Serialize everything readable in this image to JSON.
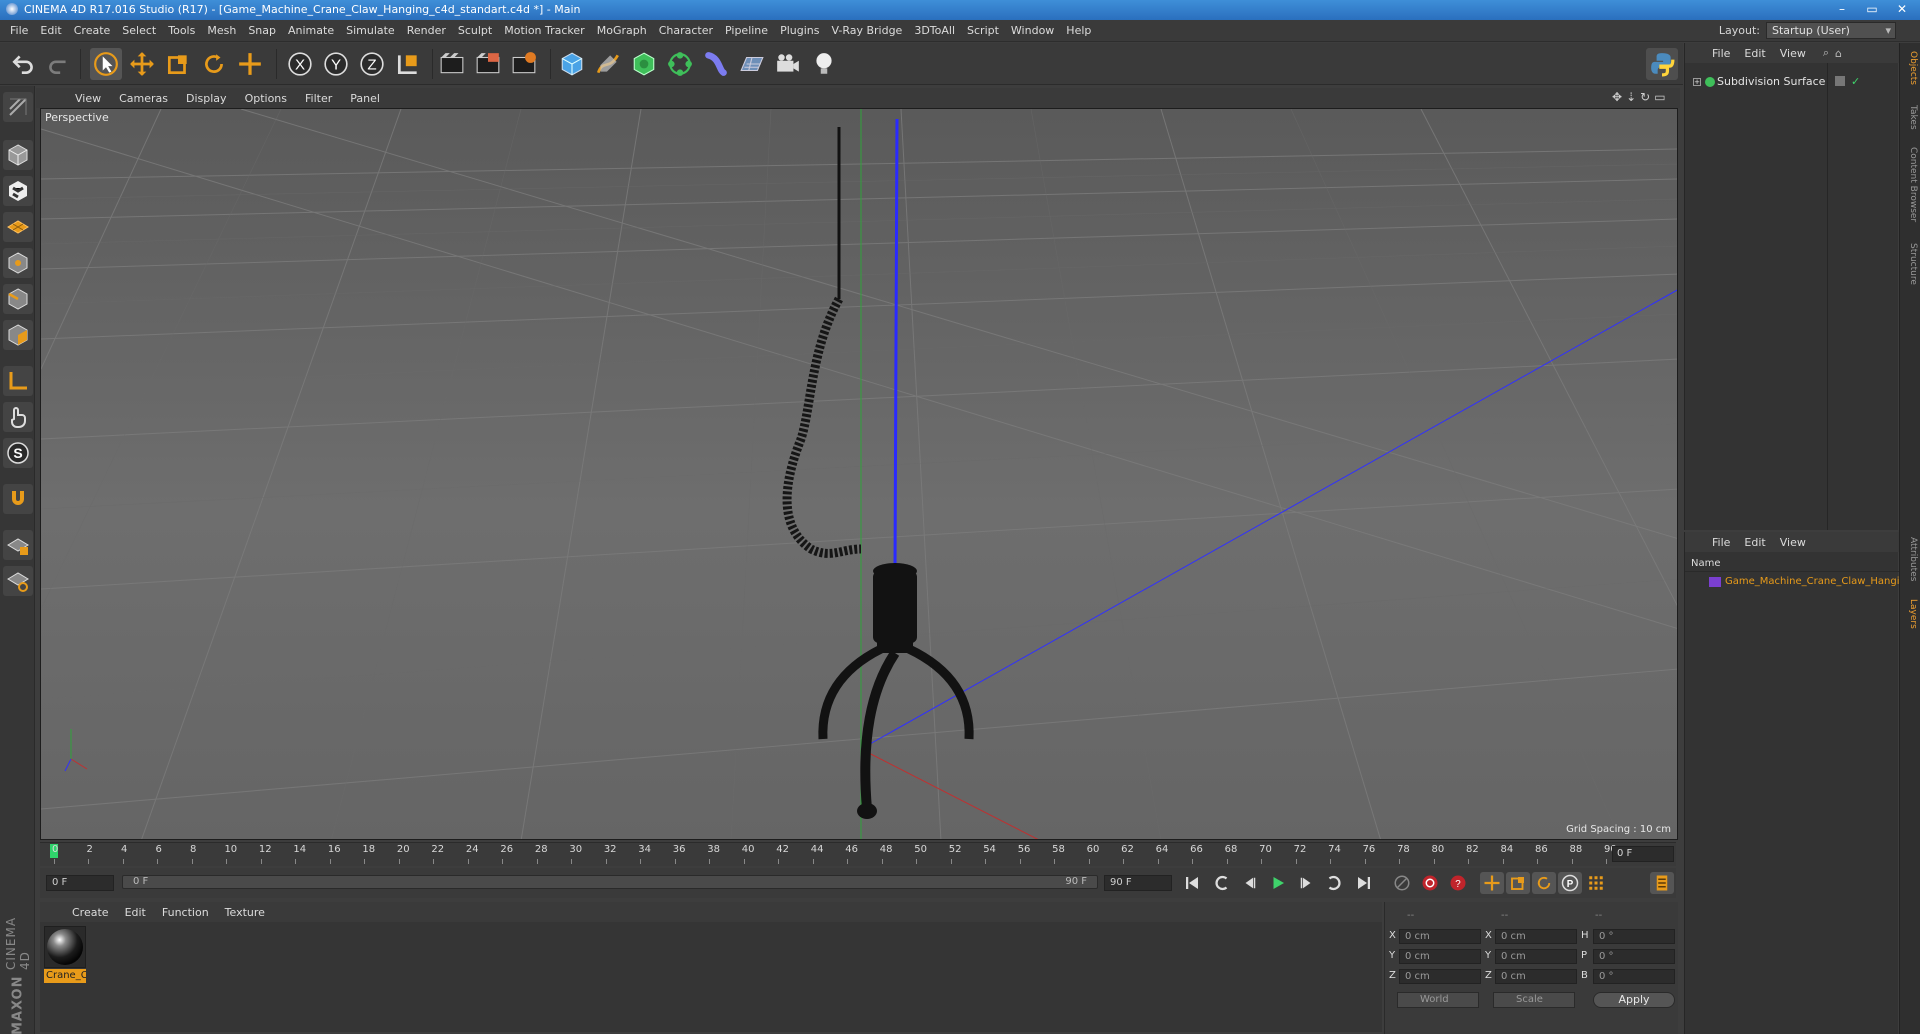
{
  "window": {
    "title": "CINEMA 4D R17.016 Studio (R17) - [Game_Machine_Crane_Claw_Hanging_c4d_standart.c4d *] - Main",
    "controls": [
      "–",
      "▭",
      "✕"
    ]
  },
  "menubar": {
    "items": [
      "File",
      "Edit",
      "Create",
      "Select",
      "Tools",
      "Mesh",
      "Snap",
      "Animate",
      "Simulate",
      "Render",
      "Sculpt",
      "Motion Tracker",
      "MoGraph",
      "Character",
      "Pipeline",
      "Plugins",
      "V-Ray Bridge",
      "3DToAll",
      "Script",
      "Window",
      "Help"
    ],
    "layout_label": "Layout:",
    "layout_value": "Startup (User)"
  },
  "toolbar": {
    "icons": [
      "undo-icon",
      "redo-icon",
      "select-arrow-icon",
      "move-icon",
      "scale-icon",
      "rotate-icon",
      "add-object-icon",
      "x-axis-icon",
      "y-axis-icon",
      "z-axis-icon",
      "world-coord-icon",
      "render-view-icon",
      "render-picture-viewer-icon",
      "edit-render-settings-icon",
      "cube-icon",
      "pen-spline-icon",
      "subdivision-icon",
      "array-icon",
      "deformer-icon",
      "floor-icon",
      "camera-icon",
      "light-icon",
      "python-icon"
    ],
    "axis_x": "X",
    "axis_y": "Y",
    "axis_z": "Z"
  },
  "left_palette": {
    "icons": [
      "make-editable-icon",
      "model-mode-icon",
      "texture-mode-icon",
      "workplane-icon",
      "points-mode-icon",
      "edges-mode-icon",
      "polygons-mode-icon",
      "axis-mode-icon",
      "tweak-mode-icon",
      "snap-icon",
      "magnet-icon",
      "lock-workplane-icon",
      "locked-grid-icon"
    ],
    "snap_letter": "S"
  },
  "viewport": {
    "menu": [
      "View",
      "Cameras",
      "Display",
      "Options",
      "Filter",
      "Panel"
    ],
    "label": "Perspective",
    "grid_spacing": "Grid Spacing : 10 cm",
    "nav_icons": [
      "move-view-icon",
      "zoom-view-icon",
      "rotate-view-icon",
      "toggle-view-icon"
    ]
  },
  "timeline": {
    "ticks": [
      "0",
      "2",
      "4",
      "6",
      "8",
      "10",
      "12",
      "14",
      "16",
      "18",
      "20",
      "22",
      "24",
      "26",
      "28",
      "30",
      "32",
      "34",
      "36",
      "38",
      "40",
      "42",
      "44",
      "46",
      "48",
      "50",
      "52",
      "54",
      "56",
      "58",
      "60",
      "62",
      "64",
      "66",
      "68",
      "70",
      "72",
      "74",
      "76",
      "78",
      "80",
      "82",
      "84",
      "86",
      "88",
      "90"
    ],
    "current_frame": "0 F"
  },
  "playback": {
    "start_field": "0 F",
    "range_start": "0 F",
    "range_end": "90 F",
    "end_field": "90 F",
    "icons": [
      "go-to-start-icon",
      "prev-key-icon",
      "prev-frame-icon",
      "play-icon",
      "next-frame-icon",
      "next-key-icon",
      "go-to-end-icon",
      "keyframe-selection-icon",
      "record-icon",
      "autokey-icon",
      "key-move-icon",
      "key-scale-icon",
      "key-rotate-icon",
      "key-param-icon",
      "key-pla-icon",
      "timeline-icon"
    ]
  },
  "material_manager": {
    "menu": [
      "Create",
      "Edit",
      "Function",
      "Texture"
    ],
    "material_name": "Crane_C"
  },
  "coordinates": {
    "header": [
      "--",
      "--",
      "--"
    ],
    "rows": [
      {
        "axis": "X",
        "pos": "0 cm",
        "size_axis": "X",
        "size": "0 cm",
        "rot_axis": "H",
        "rot": "0 °"
      },
      {
        "axis": "Y",
        "pos": "0 cm",
        "size_axis": "Y",
        "size": "0 cm",
        "rot_axis": "P",
        "rot": "0 °"
      },
      {
        "axis": "Z",
        "pos": "0 cm",
        "size_axis": "Z",
        "size": "0 cm",
        "rot_axis": "B",
        "rot": "0 °"
      }
    ],
    "mode": "World",
    "transform": "Scale",
    "apply": "Apply"
  },
  "object_manager": {
    "menu": [
      "File",
      "Edit",
      "View"
    ],
    "object_name": "Subdivision Surface"
  },
  "layer_manager": {
    "menu": [
      "File",
      "Edit",
      "View"
    ],
    "column_header": "Name",
    "layer_name": "Game_Machine_Crane_Claw_Hanging"
  },
  "side_tabs": [
    "Objects",
    "Takes",
    "Content Browser",
    "Structure",
    "Attributes",
    "Layers"
  ],
  "brand": {
    "name": "MAXON",
    "product": "CINEMA 4D"
  },
  "colors": {
    "accent": "#e89b1a",
    "playhead": "#2fd36b",
    "title_bar": "#2a6fbe",
    "axis_blue": "#3030ff",
    "axis_green": "#2fa33a",
    "axis_red": "#c03030"
  }
}
